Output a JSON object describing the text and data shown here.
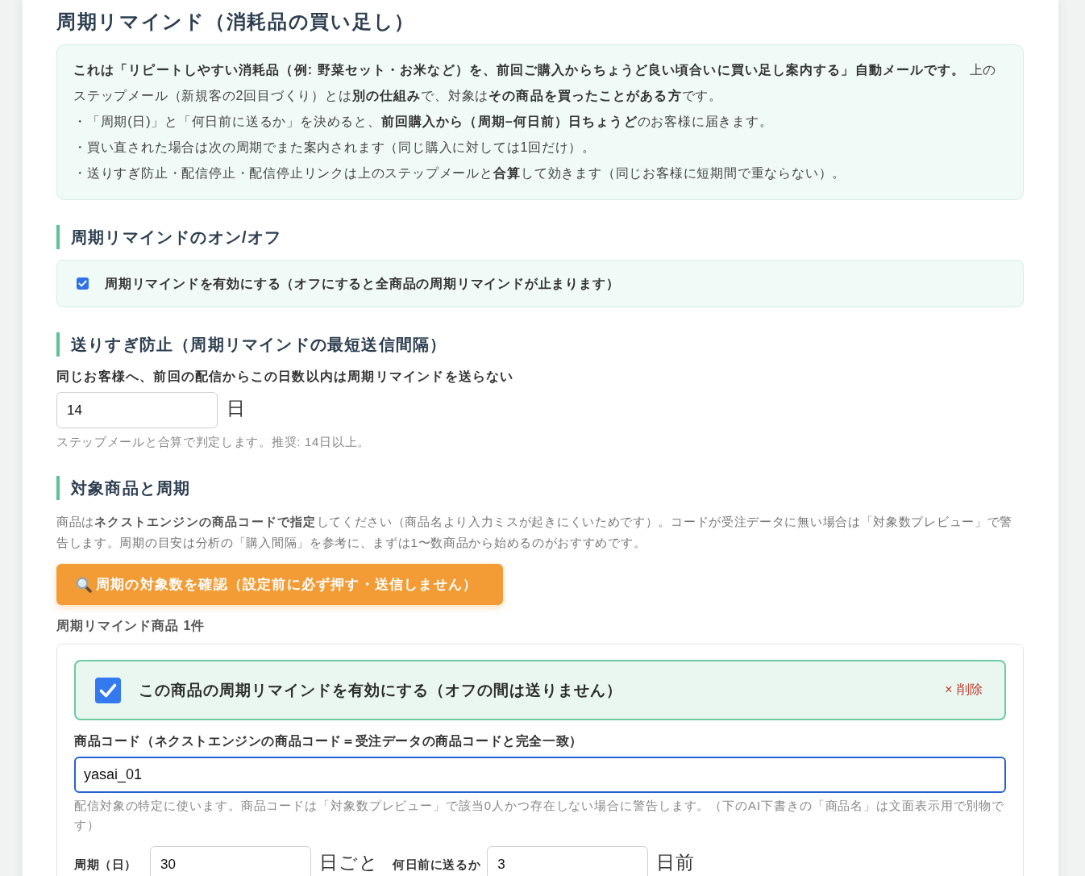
{
  "title": "周期リマインド（消耗品の買い足し）",
  "intro": {
    "text": "**これは「リピートしやすい消耗品（例: 野菜セット・お米など）を、前回ご購入からちょうど良い頃合いに買い足し案内する」自動メールです。** 上のステップメール（新規客の2回目づくり）とは**別の仕組み**で、対象は**その商品を買ったことがある方**です。",
    "bullets": [
      "・「周期(日)」と「何日前に送るか」を決めると、**前回購入から（周期–何日前）日ちょうど**のお客様に届きます。",
      "・買い直された場合は次の周期でまた案内されます（同じ購入に対しては1回だけ）。",
      "・送りすぎ防止・配信停止・配信停止リンクは上のステップメールと**合算**して効きます（同じお客様に短期間で重ならない）。"
    ]
  },
  "sections": [
    {
      "kind": "toggle",
      "heading": "周期リマインドのオン/オフ",
      "checkbox": {
        "label": "周期リマインドを有効にする（オフにすると全商品の周期リマインドが止まります）",
        "checked": true
      }
    },
    {
      "kind": "interval",
      "heading": "送りすぎ防止（周期リマインドの最短送信間隔）",
      "label": "同じお客様へ、前回の配信からこの日数以内は周期リマインドを送らない",
      "value": "14",
      "unit": "日",
      "hint": "ステップメールと合算で判定します。推奨: 14日以上。"
    },
    {
      "kind": "products",
      "heading": "対象商品と周期",
      "description": "商品は**ネクストエンジンの商品コードで指定**してください（商品名より入力ミスが起きにくいためです）。コードが受注データに無い場合は「対象数プレビュー」で警告します。周期の目安は分析の「購入間隔」を参考に、まずは1〜数商品から始めるのがおすすめです。",
      "preview_button": "周期の対象数を確認（設定前に必ず押す・送信しません）",
      "count_label": "周期リマインド商品 1件",
      "items": [
        {
          "enabled": {
            "label": "この商品の周期リマインドを有効にする（オフの間は送りません）",
            "checked": true
          },
          "delete_button": "× 削除",
          "code": {
            "label": "商品コード（ネクストエンジンの商品コード＝受注データの商品コードと完全一致）",
            "value": "yasai_01",
            "focused": true,
            "hint": "配信対象の特定に使います。商品コードは「対象数プレビュー」で該当0人かつ存在しない場合に警告します。（下のAI下書きの「商品名」は文面表示用で別物です）"
          },
          "cycle": {
            "label": "周期（日）",
            "value": "30",
            "unit": "日ごと"
          },
          "offset": {
            "label": "何日前に送るか",
            "value": "3",
            "unit": "日前"
          }
        }
      ]
    }
  ]
}
